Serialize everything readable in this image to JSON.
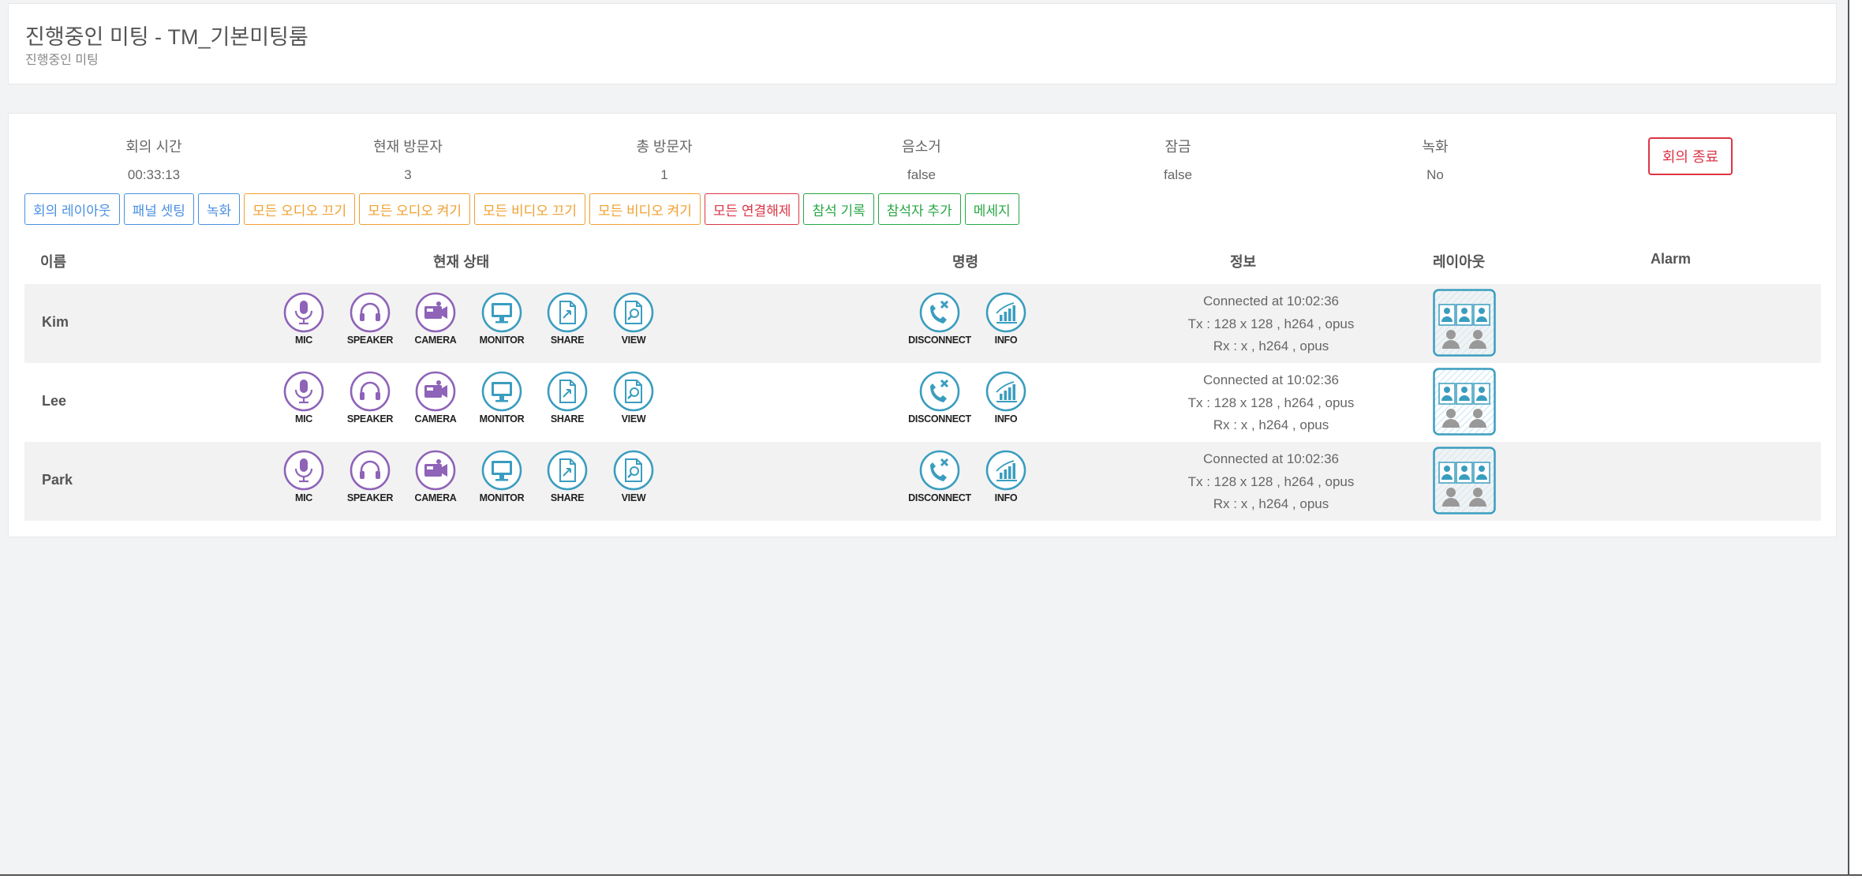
{
  "header": {
    "title": "진행중인 미팅 - TM_기본미팅룸",
    "subtitle": "진행중인 미팅"
  },
  "stats": [
    {
      "label": "회의 시간",
      "value": "00:33:13"
    },
    {
      "label": "현재 방문자",
      "value": "3"
    },
    {
      "label": "총 방문자",
      "value": "1"
    },
    {
      "label": "음소거",
      "value": "false"
    },
    {
      "label": "잠금",
      "value": "false"
    },
    {
      "label": "녹화",
      "value": "No"
    }
  ],
  "end_button": "회의 종료",
  "buttons": [
    {
      "label": "회의 레이아웃",
      "color": "blue"
    },
    {
      "label": "패널 셋팅",
      "color": "blue"
    },
    {
      "label": "녹화",
      "color": "blue"
    },
    {
      "label": "모든 오디오 끄기",
      "color": "orange"
    },
    {
      "label": "모든 오디오 켜기",
      "color": "orange"
    },
    {
      "label": "모든 비디오 끄기",
      "color": "orange"
    },
    {
      "label": "모든 비디오 켜기",
      "color": "orange"
    },
    {
      "label": "모든 연결해제",
      "color": "red"
    },
    {
      "label": "참석 기록",
      "color": "green"
    },
    {
      "label": "참석자 추가",
      "color": "green"
    },
    {
      "label": "메세지",
      "color": "green"
    }
  ],
  "columns": {
    "name": "이름",
    "status": "현재 상태",
    "command": "명령",
    "info": "정보",
    "layout": "레이아웃",
    "alarm": "Alarm"
  },
  "status_labels": [
    "MIC",
    "SPEAKER",
    "CAMERA",
    "MONITOR",
    "SHARE",
    "VIEW"
  ],
  "command_labels": [
    "DISCONNECT",
    "INFO"
  ],
  "participants": [
    {
      "name": "Kim",
      "info": [
        "Connected at 10:02:36",
        "Tx : 128 x 128 , h264 , opus",
        "Rx : x , h264 , opus"
      ]
    },
    {
      "name": "Lee",
      "info": [
        "Connected at 10:02:36",
        "Tx : 128 x 128 , h264 , opus",
        "Rx : x , h264 , opus"
      ]
    },
    {
      "name": "Park",
      "info": [
        "Connected at 10:02:36",
        "Tx : 128 x 128 , h264 , opus",
        "Rx : x , h264 , opus"
      ]
    }
  ],
  "colors": {
    "purple": "#8e63b8",
    "teal": "#3a9dbf",
    "danger": "#dc3545",
    "primary": "#4a90e2",
    "warning": "#f0a030",
    "success": "#28a745"
  }
}
